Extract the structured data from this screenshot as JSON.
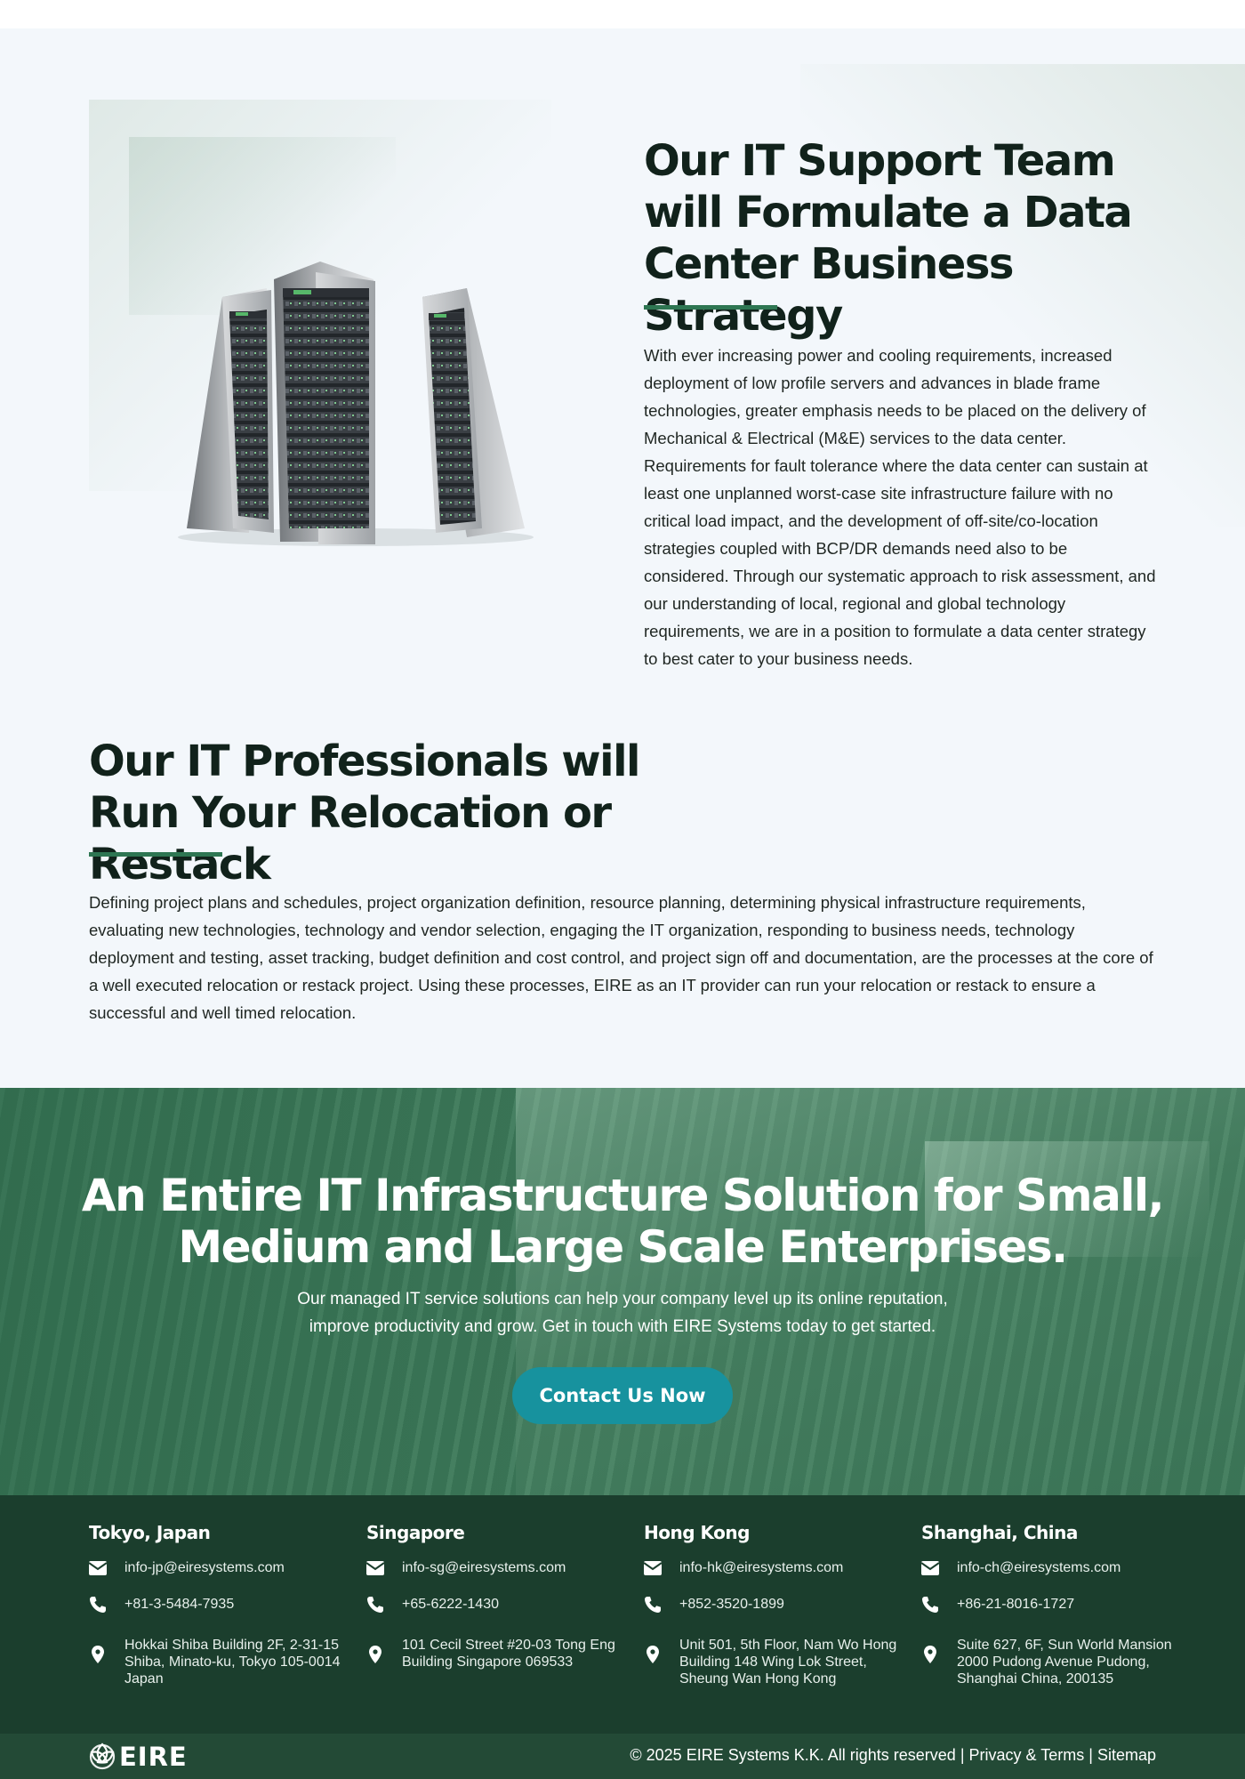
{
  "section1": {
    "title": "Our IT Support Team will Formulate a Data Center Business Strategy",
    "body": "With ever increasing power and cooling requirements, increased deployment of low profile servers and advances in blade frame technologies, greater emphasis needs to be placed on the delivery of Mechanical & Electrical (M&E) services to the data center. Requirements for fault tolerance where the data center can sustain at least one unplanned worst-case site infrastructure failure with no critical load impact, and the development of off-site/co-location strategies coupled with BCP/DR demands need also to be considered. Through our systematic approach to risk assessment, and our understanding of local, regional and global technology requirements, we are in a position to formulate a data center strategy to best cater to your business needs."
  },
  "section2": {
    "title": "Our IT Professionals will Run Your Relocation or Restack",
    "body": "Defining project plans and schedules, project organization definition, resource planning, determining physical infrastructure requirements, evaluating new technologies, technology and vendor selection, engaging the IT organization, responding to business needs, technology deployment and testing, asset tracking, budget definition and cost control, and project sign off and documentation, are the processes at the core of a well executed relocation or restack project. Using these processes, EIRE as an IT provider can run your relocation or restack to ensure a successful and well timed relocation."
  },
  "cta": {
    "title": "An Entire IT Infrastructure Solution for Small, Medium and Large Scale Enterprises.",
    "text": "Our managed IT service solutions can help your company level up its online reputation, improve productivity and grow. Get in touch with EIRE Systems today to get started.",
    "button_label": "Contact Us Now",
    "button_color": "#17929e"
  },
  "offices": [
    {
      "city": "Tokyo, Japan",
      "email": "info-jp@eiresystems.com",
      "phone": "+81-3-5484-7935",
      "address": "Hokkai Shiba Building 2F, 2-31-15 Shiba, Minato-ku, Tokyo 105-0014 Japan"
    },
    {
      "city": "Singapore",
      "email": "info-sg@eiresystems.com",
      "phone": "+65-6222-1430",
      "address": "101 Cecil Street #20-03 Tong Eng Building Singapore 069533"
    },
    {
      "city": "Hong Kong",
      "email": "info-hk@eiresystems.com",
      "phone": "+852-3520-1899",
      "address": "Unit 501, 5th Floor, Nam Wo Hong Building 148 Wing Lok Street, Sheung Wan Hong Kong"
    },
    {
      "city": "Shanghai, China",
      "email": "info-ch@eiresystems.com",
      "phone": "+86-21-8016-1727",
      "address": "Suite 627, 6F, Sun World Mansion 2000 Pudong Avenue Pudong, Shanghai China, 200135"
    }
  ],
  "footer": {
    "logo_text": "EIRE",
    "copyright": "© 2025 EIRE Systems K.K. All rights reserved",
    "separator": "|",
    "privacy_label": "Privacy & Terms",
    "sitemap_label": "Sitemap"
  },
  "icons": {
    "email": "envelope-icon",
    "phone": "phone-icon",
    "address": "map-pin-icon",
    "logo": "knot-logo-icon"
  },
  "colors": {
    "accent_green": "#2e7652",
    "footer_bg": "#1b3e2d",
    "cta_bg": "#3d7a5a"
  }
}
